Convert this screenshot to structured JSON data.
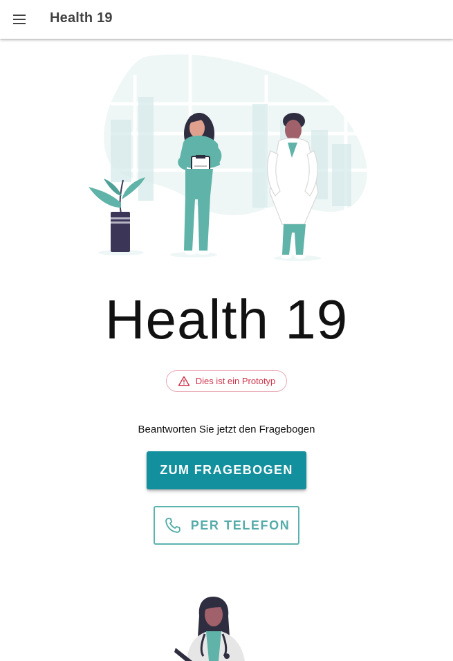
{
  "app": {
    "title": "Health 19",
    "menu_icon": "hamburger-menu-icon"
  },
  "hero": {
    "illustration": "medical-staff-illustration"
  },
  "main": {
    "headline": "Health 19",
    "prototype_notice": "Dies ist ein Prototyp",
    "prototype_icon": "warning-triangle-icon",
    "prompt": "Beantworten Sie jetzt den Fragebogen",
    "questionnaire_button": "ZUM FRAGEBOGEN",
    "phone_button": "PER TELEFON",
    "phone_icon": "phone-icon"
  },
  "colors": {
    "primary": "#13909e",
    "outline": "#5cb3ae",
    "warning": "#d0344b",
    "scrub": "#5fb3a8",
    "navy": "#3b3657"
  }
}
